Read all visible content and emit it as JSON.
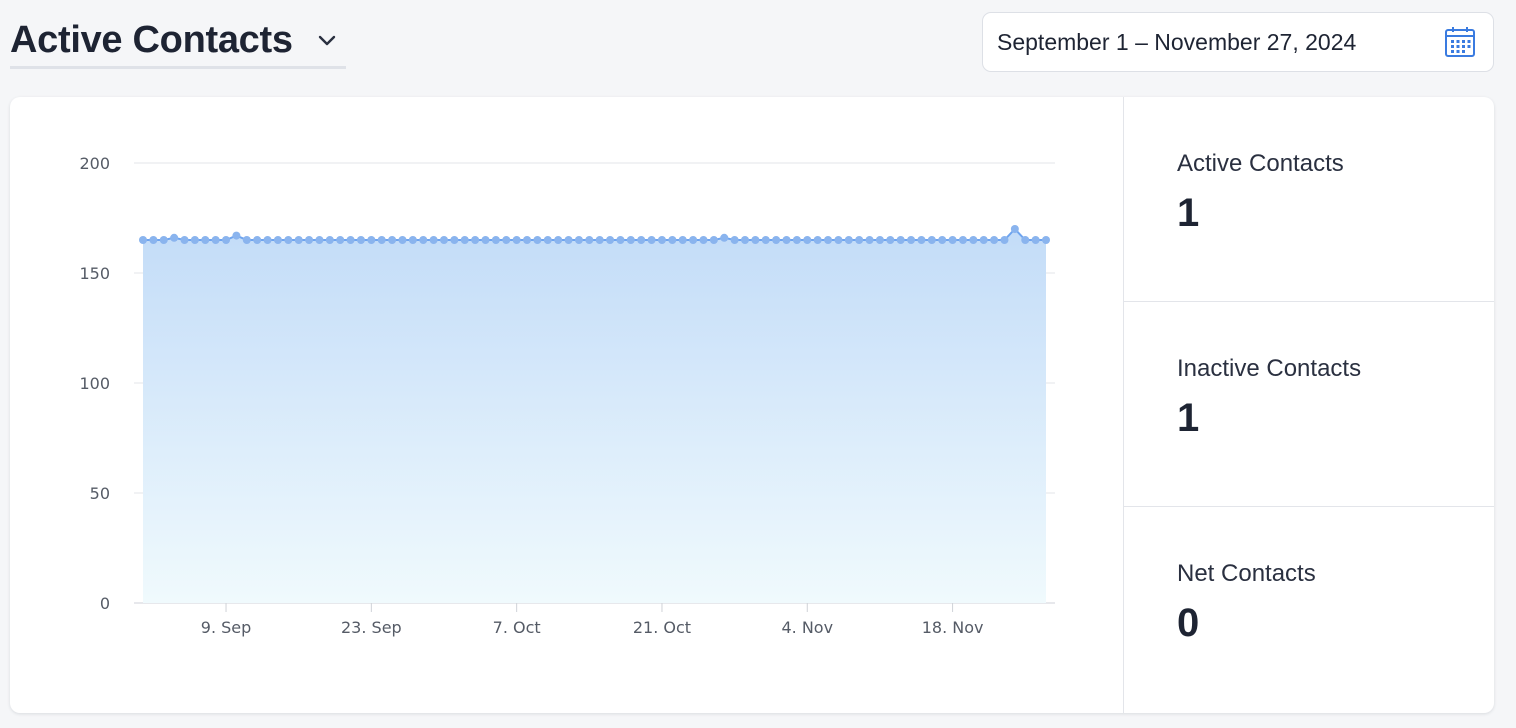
{
  "header": {
    "title": "Active Contacts",
    "date_range": "September 1 – November 27, 2024"
  },
  "colors": {
    "line": "#6ea4ef",
    "point": "#8ab4ee",
    "fill_top": "#c3dcf8",
    "fill_bottom": "#f0fafd",
    "grid": "#e3e5e9"
  },
  "stats": [
    {
      "label": "Active Contacts",
      "value": "1"
    },
    {
      "label": "Inactive Contacts",
      "value": "1"
    },
    {
      "label": "Net Contacts",
      "value": "0"
    }
  ],
  "chart_data": {
    "type": "area",
    "x_start": "2024-09-01",
    "x_end": "2024-11-27",
    "ylim": [
      0,
      200
    ],
    "y_ticks": [
      0,
      50,
      100,
      150,
      200
    ],
    "x_ticks": [
      {
        "date": "2024-09-09",
        "label": "9. Sep"
      },
      {
        "date": "2024-09-23",
        "label": "23. Sep"
      },
      {
        "date": "2024-10-07",
        "label": "7. Oct"
      },
      {
        "date": "2024-10-21",
        "label": "21. Oct"
      },
      {
        "date": "2024-11-04",
        "label": "4. Nov"
      },
      {
        "date": "2024-11-18",
        "label": "18. Nov"
      }
    ],
    "grid": true,
    "legend": "none",
    "values": [
      165,
      165,
      165,
      166,
      165,
      165,
      165,
      165,
      165,
      167,
      165,
      165,
      165,
      165,
      165,
      165,
      165,
      165,
      165,
      165,
      165,
      165,
      165,
      165,
      165,
      165,
      165,
      165,
      165,
      165,
      165,
      165,
      165,
      165,
      165,
      165,
      165,
      165,
      165,
      165,
      165,
      165,
      165,
      165,
      165,
      165,
      165,
      165,
      165,
      165,
      165,
      165,
      165,
      165,
      165,
      165,
      166,
      165,
      165,
      165,
      165,
      165,
      165,
      165,
      165,
      165,
      165,
      165,
      165,
      165,
      165,
      165,
      165,
      165,
      165,
      165,
      165,
      165,
      165,
      165,
      165,
      165,
      165,
      165,
      170,
      165,
      165,
      165
    ]
  }
}
